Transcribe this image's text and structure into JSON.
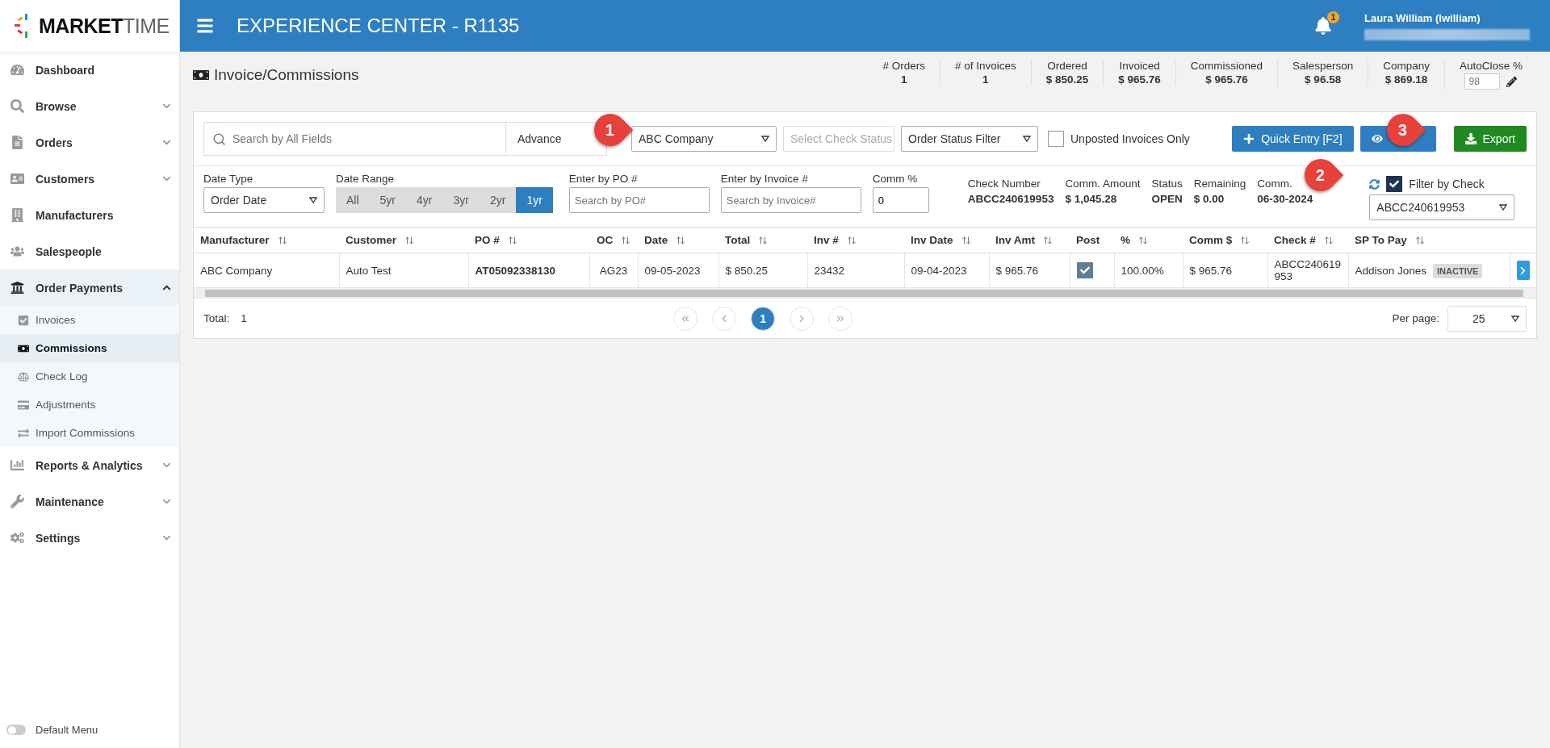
{
  "logo": {
    "bold": "MARKET",
    "light": "TIME"
  },
  "header": {
    "title": "EXPERIENCE CENTER - R1135",
    "notification_count": "1",
    "user_name": "Laura William (lwilliam)"
  },
  "sidebar": {
    "items": [
      {
        "label": "Dashboard"
      },
      {
        "label": "Browse",
        "expanded": false
      },
      {
        "label": "Orders",
        "expanded": false
      },
      {
        "label": "Customers",
        "expanded": false
      },
      {
        "label": "Manufacturers"
      },
      {
        "label": "Salespeople"
      },
      {
        "label": "Order Payments",
        "expanded": true,
        "children": [
          {
            "label": "Invoices",
            "selected": false
          },
          {
            "label": "Commissions",
            "selected": true
          },
          {
            "label": "Check Log",
            "selected": false
          },
          {
            "label": "Adjustments",
            "selected": false
          },
          {
            "label": "Import Commissions",
            "selected": false
          }
        ]
      },
      {
        "label": "Reports & Analytics",
        "expanded": false
      },
      {
        "label": "Maintenance",
        "expanded": false
      },
      {
        "label": "Settings",
        "expanded": false
      }
    ],
    "default_menu": {
      "label": "Default Menu",
      "on": false
    }
  },
  "page": {
    "title": "Invoice/Commissions"
  },
  "stats": [
    {
      "label": "# Orders",
      "value": "1"
    },
    {
      "label": "# of Invoices",
      "value": "1"
    },
    {
      "label": "Ordered",
      "value": "$ 850.25"
    },
    {
      "label": "Invoiced",
      "value": "$ 965.76"
    },
    {
      "label": "Commissioned",
      "value": "$ 965.76"
    },
    {
      "label": "Salesperson",
      "value": "$ 96.58"
    },
    {
      "label": "Company",
      "value": "$ 869.18"
    }
  ],
  "autoclose": {
    "label": "AutoClose %",
    "placeholder": "98"
  },
  "toolbar": {
    "search_placeholder": "Search by All Fields",
    "advanced": "Advance",
    "company": "ABC Company",
    "check_status_placeholder": "Select Check Status",
    "order_status_placeholder": "Order Status Filter",
    "unposted": {
      "label": "Unposted Invoices Only",
      "checked": false
    },
    "quick_entry": "Quick Entry [F2]",
    "export": "Export"
  },
  "filters": {
    "date_type": {
      "label": "Date Type",
      "value": "Order Date"
    },
    "date_range": {
      "label": "Date Range",
      "options": [
        {
          "label": "All",
          "selected": false
        },
        {
          "label": "5yr",
          "selected": false
        },
        {
          "label": "4yr",
          "selected": false
        },
        {
          "label": "3yr",
          "selected": false
        },
        {
          "label": "2yr",
          "selected": false
        },
        {
          "label": "1yr",
          "selected": true
        }
      ]
    },
    "po": {
      "label": "Enter by PO #",
      "placeholder": "Search by PO#"
    },
    "invoice": {
      "label": "Enter by Invoice #",
      "placeholder": "Search by Invoice#"
    },
    "comm_pct": {
      "label": "Comm %",
      "value": "0"
    }
  },
  "check_info": [
    {
      "label": "Check Number",
      "value": "ABCC240619953"
    },
    {
      "label": "Comm. Amount",
      "value": "$ 1,045.28"
    },
    {
      "label": "Status",
      "value": "OPEN"
    },
    {
      "label": "Remaining",
      "value": "$ 0.00"
    },
    {
      "label": "Comm.",
      "value": "06-30-2024"
    }
  ],
  "filter_by_check": {
    "label": "Filter by Check",
    "checked": true,
    "value": "ABCC240619953"
  },
  "table": {
    "columns": [
      {
        "label": "Manufacturer",
        "sortable": true
      },
      {
        "label": "Customer",
        "sortable": true
      },
      {
        "label": "PO #",
        "sortable": true
      },
      {
        "label": "OC",
        "sortable": true
      },
      {
        "label": "Date",
        "sortable": true
      },
      {
        "label": "Total",
        "sortable": true
      },
      {
        "label": "Inv #",
        "sortable": true
      },
      {
        "label": "Inv Date",
        "sortable": true
      },
      {
        "label": "Inv Amt",
        "sortable": true
      },
      {
        "label": "Post",
        "sortable": false
      },
      {
        "label": "%",
        "sortable": true
      },
      {
        "label": "Comm $",
        "sortable": true
      },
      {
        "label": "Check #",
        "sortable": true
      },
      {
        "label": "SP To Pay",
        "sortable": true
      }
    ],
    "rows": [
      {
        "manufacturer": "ABC Company",
        "customer": "Auto Test",
        "po": "AT05092338130",
        "oc": "AG23",
        "date": "09-05-2023",
        "total": "$ 850.25",
        "inv": "23432",
        "inv_date": "09-04-2023",
        "inv_amt": "$ 965.76",
        "posted": true,
        "pct": "100.00%",
        "comm": "$ 965.76",
        "check": "ABCC240619953",
        "sp": "Addison Jones",
        "sp_badge": "INACTIVE"
      }
    ]
  },
  "pagination": {
    "total_label": "Total:",
    "total": "1",
    "pages": [
      {
        "label": "1",
        "selected": true
      }
    ],
    "per_page_label": "Per page:",
    "per_page": "25"
  },
  "callouts": [
    "1",
    "2",
    "3"
  ]
}
